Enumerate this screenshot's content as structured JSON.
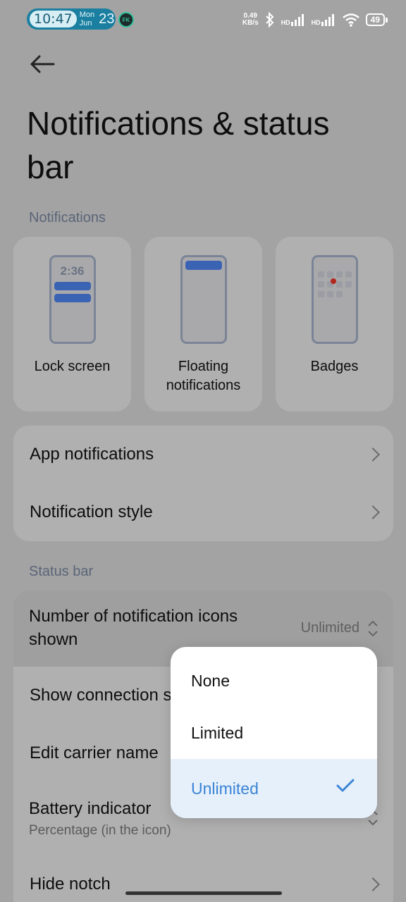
{
  "status_bar": {
    "time": "10:47",
    "date_month": "Mon",
    "date_weekday": "Jun",
    "date_day": "23",
    "net_speed_value": "0.49",
    "net_speed_unit": "KB/s",
    "sim1_label": "HD",
    "sim2_label": "HD",
    "battery": "49",
    "app_icon_text": "FK"
  },
  "page": {
    "title": "Notifications & status bar"
  },
  "notifications_section": {
    "label": "Notifications",
    "tiles": [
      {
        "label": "Lock screen",
        "preview_time": "2:36"
      },
      {
        "label": "Floating notifications"
      },
      {
        "label": "Badges"
      }
    ],
    "rows": [
      {
        "label": "App notifications"
      },
      {
        "label": "Notification style"
      }
    ]
  },
  "status_bar_section": {
    "label": "Status bar",
    "rows": [
      {
        "label": "Number of notification icons shown",
        "value": "Unlimited"
      },
      {
        "label": "Show connection speed"
      },
      {
        "label": "Edit carrier name"
      },
      {
        "label": "Battery indicator",
        "sublabel": "Percentage (in the icon)"
      },
      {
        "label": "Hide notch"
      }
    ]
  },
  "dropdown": {
    "options": [
      {
        "label": "None",
        "selected": false
      },
      {
        "label": "Limited",
        "selected": false
      },
      {
        "label": "Unlimited",
        "selected": true
      }
    ],
    "accent_color": "#3c84d6"
  },
  "icons": {
    "back": "arrow-left-icon",
    "chevron": "chevron-right-icon",
    "updown": "chevron-up-down-icon",
    "check": "checkmark-icon"
  }
}
